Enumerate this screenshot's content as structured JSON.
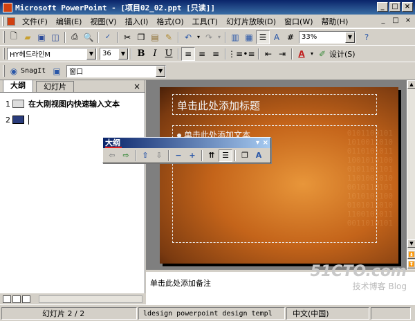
{
  "window": {
    "title": "Microsoft PowerPoint - [项目02_02.ppt [只读]]",
    "controls": [
      "_",
      "□",
      "×"
    ]
  },
  "menubar": {
    "items": [
      "文件(F)",
      "编辑(E)",
      "视图(V)",
      "插入(I)",
      "格式(O)",
      "工具(T)",
      "幻灯片放映(D)",
      "窗口(W)",
      "帮助(H)"
    ],
    "right_controls": [
      "_",
      "□",
      "×"
    ]
  },
  "standard_toolbar": {
    "zoom": "33%"
  },
  "formatting_toolbar": {
    "font": "HY헤드라인M",
    "size": "36",
    "bold": "B",
    "italic": "I",
    "underline": "U",
    "design_label": "设计(S)",
    "font_color_glyph": "A"
  },
  "snagit_toolbar": {
    "snagit_label": "SnagIt",
    "window_combo": "窗口"
  },
  "left_pane": {
    "tabs": [
      "大纲",
      "幻灯片"
    ],
    "close": "×",
    "rows": [
      {
        "num": "1",
        "text": "在大刚视图内快速输入文本"
      },
      {
        "num": "2",
        "text": ""
      }
    ]
  },
  "slide": {
    "title_placeholder": "单击此处添加标题",
    "body_placeholder": "单击此处添加文本",
    "binary_texture": "0101100101\n1010011010\n0110101011\n1001010100\n0101101101\n1101001010\n0010110101\n1010101100\n0101011010\n1100101011\n0011010101"
  },
  "notes": {
    "placeholder": "单击此处添加备注"
  },
  "watermark": {
    "site": "51CTO.com",
    "line2": "技术博客",
    "line3": "Blog"
  },
  "floating_toolbar": {
    "title": "大纲",
    "menu_glyph": "▾",
    "close": "×"
  },
  "statusbar": {
    "slide_info": "幻灯片 2 / 2",
    "design": "ldesign powerpoint design templ",
    "language": "中文(中国)"
  }
}
